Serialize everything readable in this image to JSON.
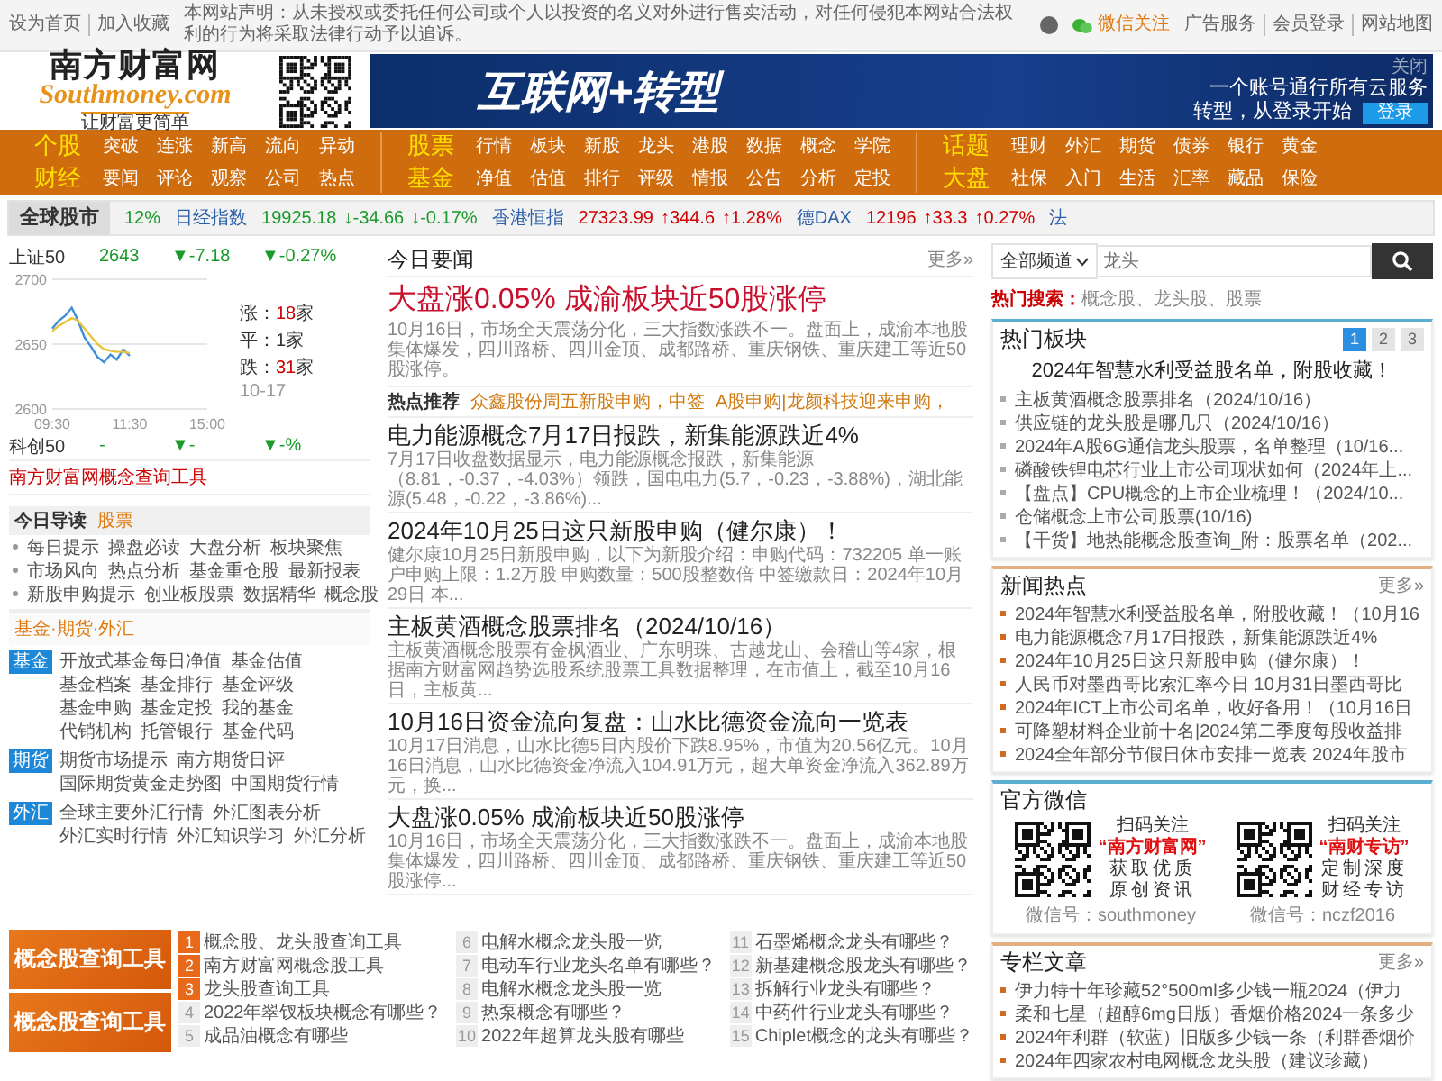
{
  "top_bar": {
    "left_links": [
      "设为首页",
      "加入收藏"
    ],
    "notice": "本网站声明：从未授权或委托任何公司或个人以投资的名义对外进行售卖活动，对任何侵犯本网站合法权利的行为将采取法律行动予以追诉。",
    "wechat": "微信关注",
    "right_links": [
      "广告服务",
      "会员登录",
      "网站地图"
    ]
  },
  "header": {
    "logo": {
      "name": "南方财富网",
      "domain": "Southmoney.com",
      "slogan": "让财富更简单"
    },
    "banner": {
      "headline": "互联网+转型",
      "line1": "一个账号通行所有云服务",
      "line2": "转型，从登录开始",
      "button": "登录",
      "close": "关闭"
    }
  },
  "nav": [
    {
      "rows": [
        {
          "title": "个股",
          "links": [
            "突破",
            "连涨",
            "新高",
            "流向",
            "异动"
          ]
        },
        {
          "title": "财经",
          "links": [
            "要闻",
            "评论",
            "观察",
            "公司",
            "热点"
          ]
        }
      ]
    },
    {
      "rows": [
        {
          "title": "股票",
          "links": [
            "行情",
            "板块",
            "新股",
            "龙头",
            "港股",
            "数据",
            "概念",
            "学院"
          ]
        },
        {
          "title": "基金",
          "links": [
            "净值",
            "估值",
            "排行",
            "评级",
            "情报",
            "公告",
            "分析",
            "定投"
          ]
        }
      ]
    },
    {
      "rows": [
        {
          "title": "话题",
          "links": [
            "理财",
            "外汇",
            "期货",
            "债券",
            "银行",
            "黄金"
          ]
        },
        {
          "title": "大盘",
          "links": [
            "社保",
            "入门",
            "生活",
            "汇率",
            "藏品",
            "保险"
          ]
        }
      ]
    }
  ],
  "ticker": {
    "label": "全球股市",
    "lead": "12%",
    "items": [
      {
        "name": "日经指数",
        "value": "19925.18",
        "change": "↓-34.66",
        "pct": "↓-0.17%",
        "color": "#1a9a2a"
      },
      {
        "name": "香港恒指",
        "value": "27323.99",
        "change": "↑344.6",
        "pct": "↑1.28%",
        "color": "#d00000"
      },
      {
        "name": "德DAX",
        "value": "12196",
        "change": "↑33.3",
        "pct": "↑0.27%",
        "color": "#d00000"
      }
    ],
    "tail": "法"
  },
  "search": {
    "channel": "全部频道",
    "placeholder": "龙头",
    "hot_label": "热门搜索：",
    "hot_terms": "概念股、龙头股、股票"
  },
  "index_box": {
    "main": {
      "name": "上证50",
      "value": "2643",
      "change": "▼-7.18",
      "pct": "▼-0.27%",
      "color": "#1a9a2a"
    },
    "chart_data": {
      "type": "line",
      "categories": [
        "09:30",
        null,
        null,
        null,
        null,
        null,
        null,
        null,
        null,
        null,
        null,
        null,
        "11:30",
        null,
        null,
        null,
        null,
        null,
        null,
        null,
        null,
        null,
        null,
        null,
        "15:00"
      ],
      "ylim": [
        2600,
        2700
      ],
      "yticks": [
        2600,
        2650,
        2700
      ],
      "series": [
        {
          "color": "#3a8fd8",
          "values": [
            2662,
            2668,
            2672,
            2678,
            2668,
            2655,
            2648,
            2640,
            2636,
            2642,
            2638,
            2646,
            2641,
            null,
            null,
            null,
            null,
            null,
            null,
            null,
            null,
            null,
            null,
            null,
            null
          ]
        },
        {
          "color": "#e8c440",
          "values": [
            2660,
            2664,
            2667,
            2670,
            2668,
            2662,
            2656,
            2650,
            2646,
            2645,
            2644,
            2644,
            2643,
            null,
            null,
            null,
            null,
            null,
            null,
            null,
            null,
            null,
            null,
            null,
            null
          ]
        }
      ]
    },
    "stats": [
      {
        "label": "涨：",
        "count": "18",
        "unit": "家",
        "color": "#cc0000"
      },
      {
        "label": "平：",
        "count": "1",
        "unit": "家",
        "color": "#333333"
      },
      {
        "label": "跌：",
        "count": "31",
        "unit": "家",
        "color": "#cc0000"
      }
    ],
    "date": "10-17",
    "second": {
      "name": "科创50",
      "value": "-",
      "change": "▼-",
      "pct": "▼-%",
      "color": "#1a9a2a"
    },
    "link": "南方财富网概念查询工具"
  },
  "top_news": {
    "title": "今日要闻",
    "more": "更多»",
    "lead": {
      "title": "大盘涨0.05% 成渝板块近50股涨停",
      "summary": "10月16日，市场全天震荡分化，三大指数涨跌不一。盘面上，成渝本地股集体爆发，四川路桥、四川金顶、成都路桥、重庆钢铁、重庆建工等近50股涨停。"
    },
    "hot": {
      "label": "热点推荐",
      "items": [
        "众鑫股份周五新股申购，中签",
        "A股申购|龙颜科技迎来申购，"
      ]
    },
    "items": [
      {
        "title": "电力能源概念7月17日报跌，新集能源跌近4%",
        "summary": "7月17日收盘数据显示，电力能源概念报跌，新集能源（8.81，-0.37，-4.03%）领跌，国电电力(5.7，-0.23，-3.88%)，湖北能源(5.48，-0.22，-3.86%)..."
      },
      {
        "title": "2024年10月25日这只新股申购（健尔康）！",
        "summary": "健尔康10月25日新股申购，以下为新股介绍：申购代码：732205 单一账户申购上限：1.2万股 申购数量：500股整数倍 中签缴款日：2024年10月29日 本..."
      },
      {
        "title": "主板黄酒概念股票排名（2024/10/16）",
        "summary": "主板黄酒概念股票有金枫酒业、广东明珠、古越龙山、会稽山等4家，根据南方财富网趋势选股系统股票工具数据整理，在市值上，截至10月16日，主板黄..."
      },
      {
        "title": "10月16日资金流向复盘：山水比德资金流向一览表",
        "summary": "10月17日消息，山水比德5日内股价下跌8.95%，市值为20.56亿元。10月16日消息，山水比德资金净流入104.91万元，超大单资金净流入362.89万元，换..."
      },
      {
        "title": "大盘涨0.05% 成渝板块近50股涨停",
        "summary": "10月16日，市场全天震荡分化，三大指数涨跌不一。盘面上，成渝本地股集体爆发，四川路桥、四川金顶、成都路桥、重庆钢铁、重庆建工等近50股涨停..."
      }
    ]
  },
  "reading": {
    "title": "今日导读",
    "tab": "股票",
    "rows": [
      [
        "每日提示",
        "操盘必读",
        "大盘分析",
        "板块聚焦"
      ],
      [
        "市场风向",
        "热点分析",
        "基金重仓股",
        "最新报表"
      ],
      [
        "新股申购提示",
        "创业板股票",
        "数据精华",
        "概念股"
      ]
    ],
    "section": "基金·期货·外汇",
    "groups": [
      {
        "badge": "基金",
        "links": [
          "开放式基金每日净值",
          "基金估值",
          "基金档案",
          "基金排行",
          "基金评级",
          "基金申购",
          "基金定投",
          "我的基金",
          "代销机构",
          "托管银行",
          "基金代码"
        ]
      },
      {
        "badge": "期货",
        "links": [
          "期货市场提示",
          "南方期货日评",
          "国际期货黄金走势图",
          "中国期货行情"
        ]
      },
      {
        "badge": "外汇",
        "links": [
          "全球主要外汇行情",
          "外汇图表分析",
          "外汇实时行情",
          "外汇知识学习",
          "外汇分析"
        ]
      }
    ]
  },
  "tools": {
    "banners": [
      "概念股查询工具",
      "概念股查询工具"
    ],
    "list": [
      {
        "num": "1",
        "text": "概念股、龙头股查询工具",
        "highlighted": true
      },
      {
        "num": "2",
        "text": "南方财富网概念股工具",
        "highlighted": true
      },
      {
        "num": "3",
        "text": "龙头股查询工具",
        "highlighted": true
      },
      {
        "num": "4",
        "text": "2022年翠钗板块概念有哪些？",
        "highlighted": false
      },
      {
        "num": "5",
        "text": "成品油概念有哪些",
        "highlighted": false
      },
      {
        "num": "6",
        "text": "电解水概念龙头股一览",
        "highlighted": false
      },
      {
        "num": "7",
        "text": "电动车行业龙头名单有哪些？",
        "highlighted": false
      },
      {
        "num": "8",
        "text": "电解水概念龙头股一览",
        "highlighted": false
      },
      {
        "num": "9",
        "text": "热泵概念有哪些？",
        "highlighted": false
      },
      {
        "num": "10",
        "text": "2022年超算龙头股有哪些",
        "highlighted": false
      },
      {
        "num": "11",
        "text": "石墨烯概念龙头有哪些？",
        "highlighted": false
      },
      {
        "num": "12",
        "text": "新基建概念股龙头有哪些？",
        "highlighted": false
      },
      {
        "num": "13",
        "text": "拆解行业龙头有哪些？",
        "highlighted": false
      },
      {
        "num": "14",
        "text": "中药件行业龙头有哪些？",
        "highlighted": false
      },
      {
        "num": "15",
        "text": "Chiplet概念的龙头有哪些？",
        "highlighted": false
      }
    ]
  },
  "hot_sectors": {
    "title": "热门板块",
    "pages": [
      {
        "label": "1",
        "selected": true
      },
      {
        "label": "2",
        "selected": false
      },
      {
        "label": "3",
        "selected": false
      }
    ],
    "featured": "2024年智慧水利受益股名单，附股收藏！",
    "items": [
      "主板黄酒概念股票排名（2024/10/16）",
      "供应链的龙头股是哪几只（2024/10/16）",
      "2024年A股6G通信龙头股票，名单整理（10/16...",
      "磷酸铁锂电芯行业上市公司现状如何（2024年上...",
      "【盘点】CPU概念的上市企业梳理！（2024/10...",
      "仓储概念上市公司股票(10/16)",
      "【干货】地热能概念股查询_附：股票名单（202..."
    ]
  },
  "news_hot": {
    "title": "新闻热点",
    "more": "更多»",
    "items": [
      "2024年智慧水利受益股名单，附股收藏！（10月16",
      "电力能源概念7月17日报跌，新集能源跌近4%",
      "2024年10月25日这只新股申购（健尔康）！",
      "人民币对墨西哥比索汇率今日 10月31日墨西哥比",
      "2024年ICT上市公司名单，收好备用！（10月16日",
      "可降塑材料企业前十名|2024第二季度每股收益排",
      "2024全年部分节假日休市安排一览表 2024年股市"
    ]
  },
  "wechat": {
    "title": "官方微信",
    "accounts": [
      {
        "caption": "扫码关注",
        "name": "“南方财富网”",
        "lines": [
          "获取优质",
          "原创资讯"
        ],
        "id": "微信号：southmoney"
      },
      {
        "caption": "扫码关注",
        "name": "“南财专访”",
        "lines": [
          "定制深度",
          "财经专访"
        ],
        "id": "微信号：nczf2016"
      }
    ]
  },
  "columns": {
    "title": "专栏文章",
    "more": "更多»",
    "items": [
      "伊力特十年珍藏52°500ml多少钱一瓶2024（伊力",
      "柔和七星（超醇6mg日版）香烟价格2024一条多少",
      "2024年利群（软蓝）旧版多少钱一条（利群香烟价",
      "2024年四家农村电网概念龙头股（建议珍藏）"
    ]
  }
}
